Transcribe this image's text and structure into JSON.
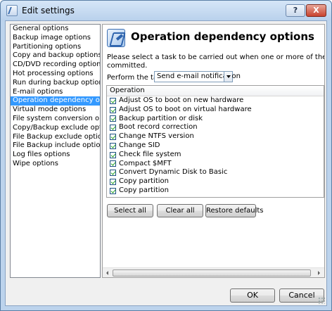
{
  "window": {
    "title": "Edit settings",
    "help_label": "?",
    "close_label": "X"
  },
  "sidebar": {
    "items": [
      {
        "label": "General options"
      },
      {
        "label": "Backup image options"
      },
      {
        "label": "Partitioning options"
      },
      {
        "label": "Copy and backup options"
      },
      {
        "label": "CD/DVD recording options"
      },
      {
        "label": "Hot processing options"
      },
      {
        "label": "Run during backup options"
      },
      {
        "label": "E-mail options"
      },
      {
        "label": "Operation dependency options"
      },
      {
        "label": "Virtual mode options"
      },
      {
        "label": "File system conversion options"
      },
      {
        "label": "Copy/Backup exclude options"
      },
      {
        "label": "File Backup exclude options"
      },
      {
        "label": "File Backup include options"
      },
      {
        "label": "Log files options"
      },
      {
        "label": "Wipe options"
      }
    ],
    "selected_index": 8
  },
  "main": {
    "title": "Operation dependency options",
    "description_line1": "Please select a task to be carried out when one or more of the following operations a",
    "description_line2": "committed.",
    "perform_task_label": "Perform the task:",
    "task_select_value": "Send e-mail notification",
    "list_header": "Operation",
    "operations": [
      {
        "label": "Adjust OS to boot on new hardware",
        "checked": true
      },
      {
        "label": "Adjust OS to boot on virtual hardware",
        "checked": true
      },
      {
        "label": "Backup partition or disk",
        "checked": true
      },
      {
        "label": "Boot record correction",
        "checked": true
      },
      {
        "label": "Change NTFS version",
        "checked": true
      },
      {
        "label": "Change SID",
        "checked": true
      },
      {
        "label": "Check file system",
        "checked": true
      },
      {
        "label": "Compact $MFT",
        "checked": true
      },
      {
        "label": "Convert Dynamic Disk to Basic",
        "checked": true
      },
      {
        "label": "Copy partition",
        "checked": true
      },
      {
        "label": "Copy partition",
        "checked": true
      }
    ],
    "select_all_label": "Select all",
    "clear_all_label": "Clear all",
    "restore_defaults_label": "Restore defaults"
  },
  "footer": {
    "ok_label": "OK",
    "cancel_label": "Cancel"
  }
}
